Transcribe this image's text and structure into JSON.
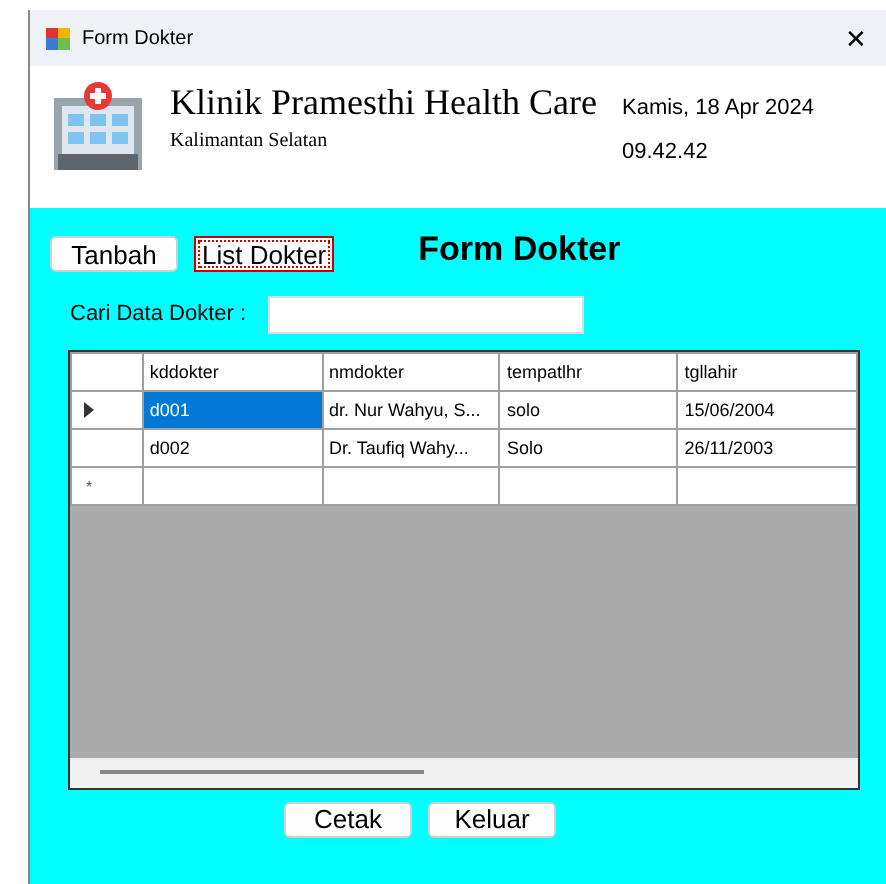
{
  "window": {
    "title": "Form Dokter",
    "close_glyph": "✕"
  },
  "header": {
    "clinic_name": "Klinik Pramesthi Health Care",
    "region": "Kalimantan Selatan",
    "date": "Kamis, 18 Apr 2024",
    "time": "09.42.42"
  },
  "toolbar": {
    "buttons": [
      {
        "label": "Tanbah",
        "focused": false
      },
      {
        "label": "List Dokter",
        "focused": true
      }
    ],
    "form_title": "Form Dokter"
  },
  "search": {
    "label": "Cari Data Dokter :"
  },
  "table": {
    "columns": [
      "kddokter",
      "nmdokter",
      "tempatlhr",
      "tgllahir"
    ],
    "rows": [
      {
        "selected": true,
        "cells": [
          "d001",
          "dr. Nur Wahyu, S...",
          "solo",
          "15/06/2004"
        ]
      },
      {
        "selected": false,
        "cells": [
          "d002",
          "Dr. Taufiq Wahy...",
          "Solo",
          "26/11/2003"
        ]
      }
    ],
    "new_row_marker": "*"
  },
  "footer_buttons": [
    "Cetak",
    "Keluar"
  ]
}
